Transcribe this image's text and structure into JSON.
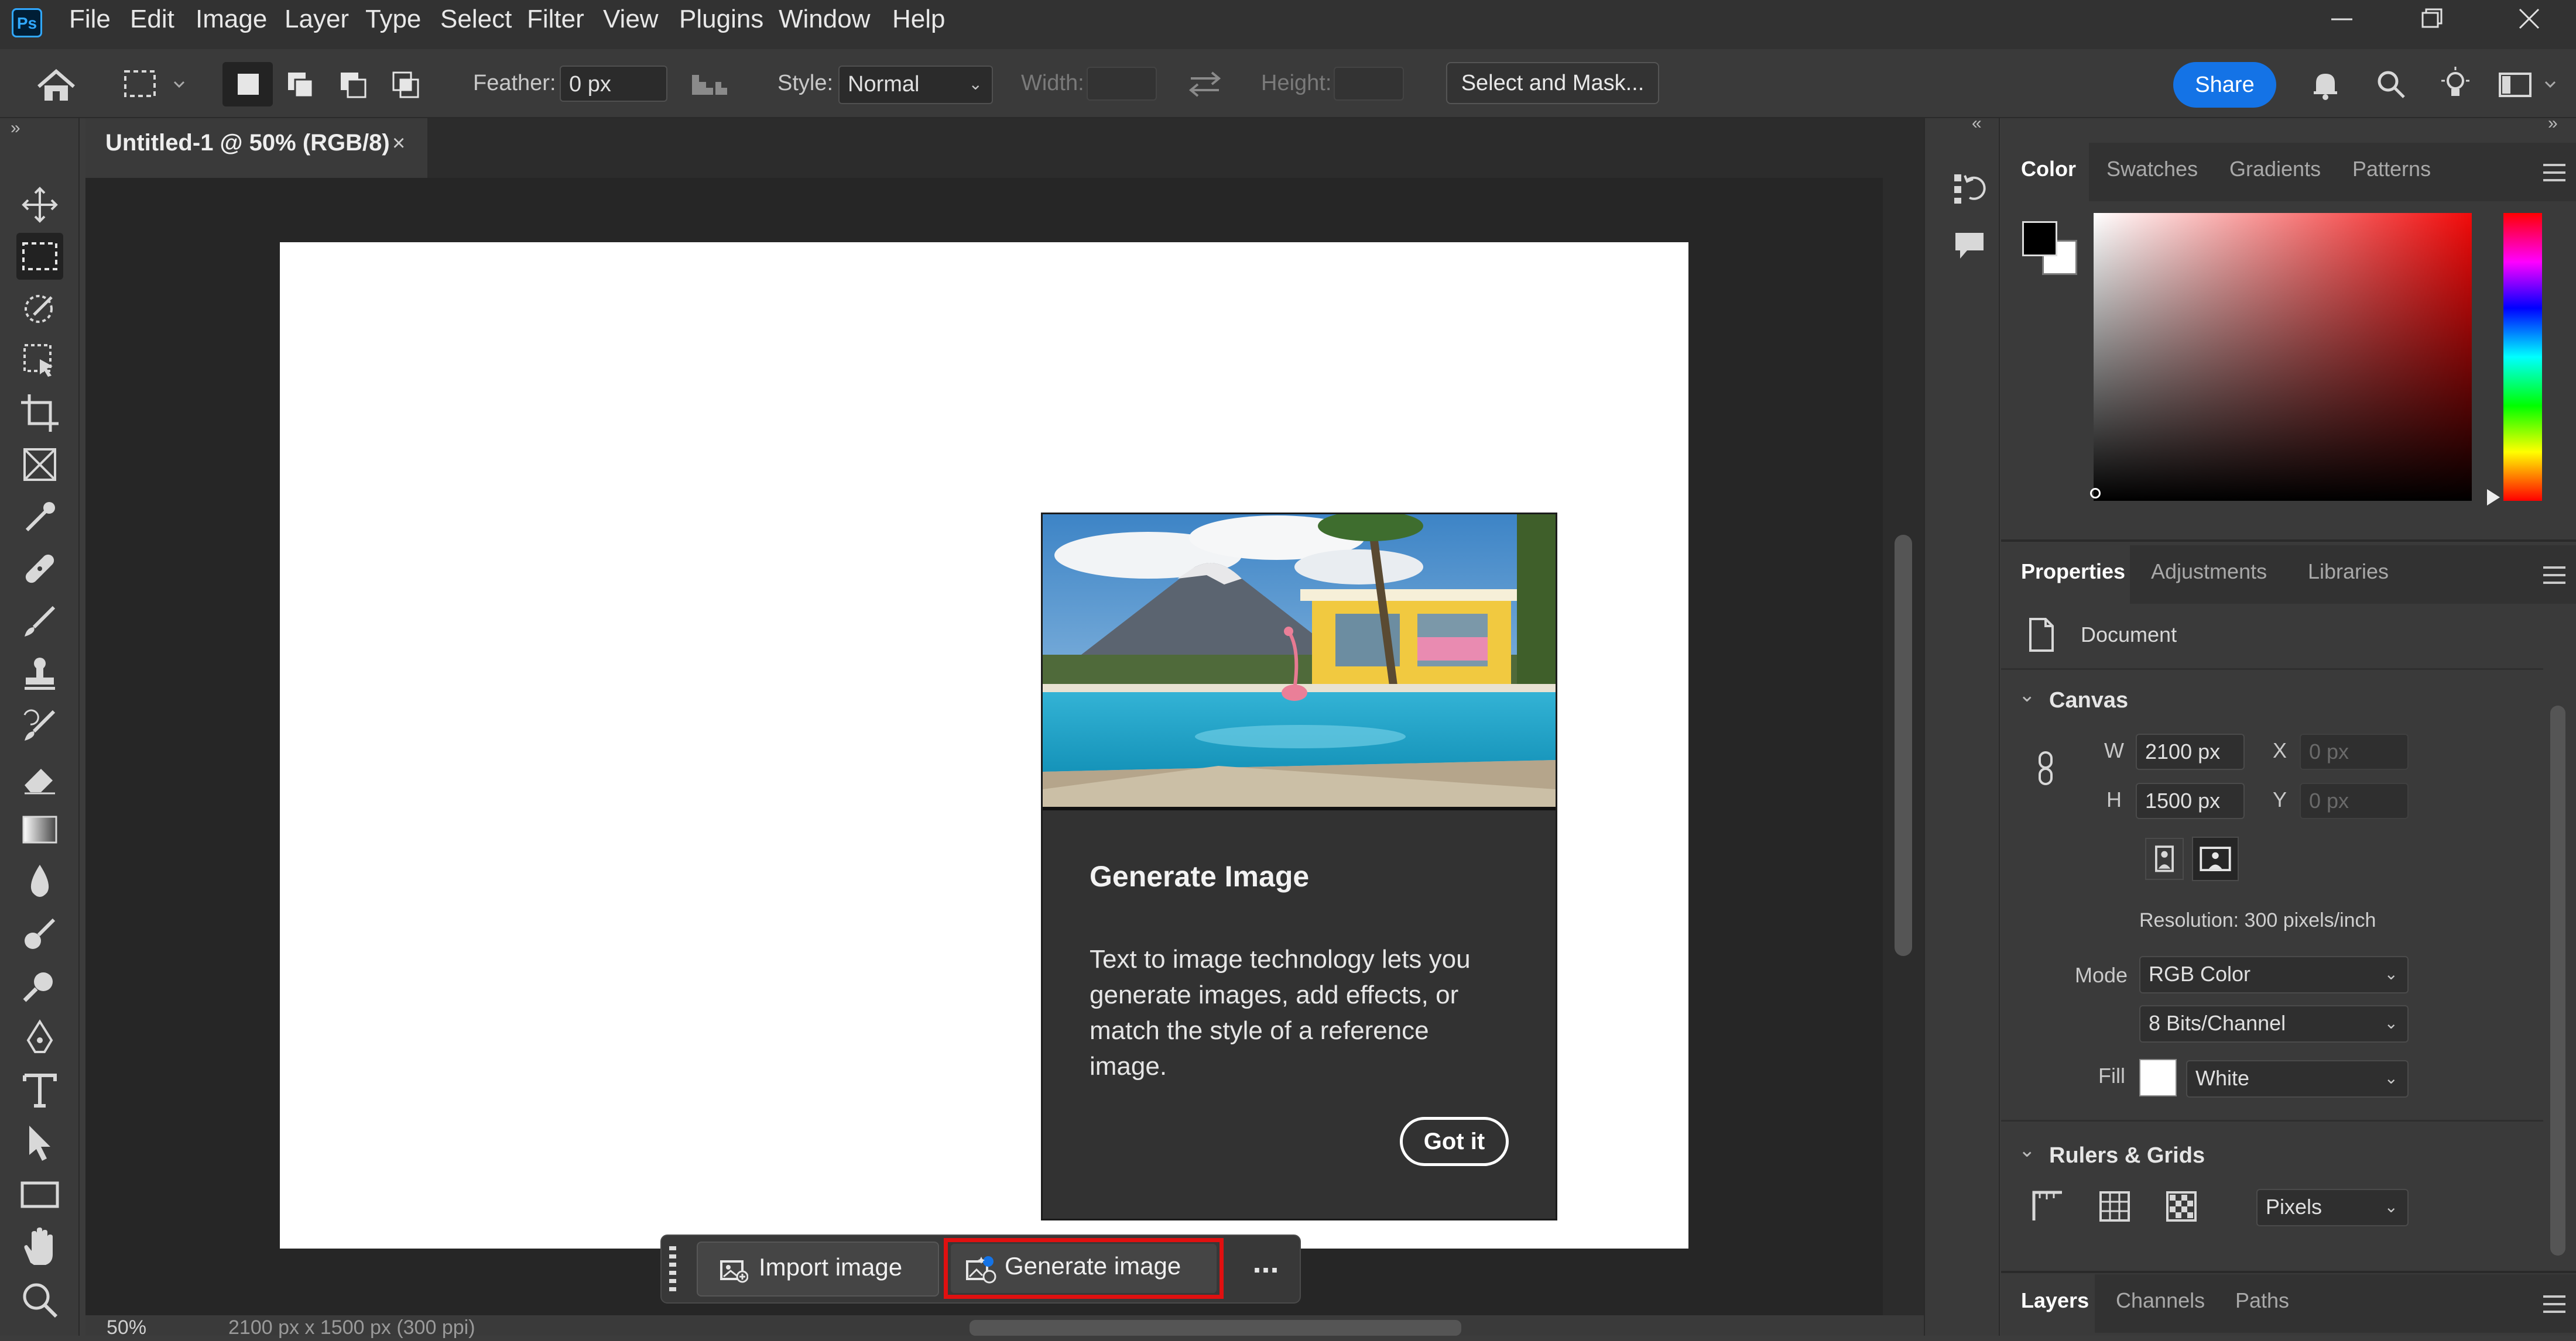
{
  "app": {
    "logo": "Ps"
  },
  "menu": [
    "File",
    "Edit",
    "Image",
    "Layer",
    "Type",
    "Select",
    "Filter",
    "View",
    "Plugins",
    "Window",
    "Help"
  ],
  "options": {
    "feather_label": "Feather:",
    "feather_value": "0 px",
    "style_label": "Style:",
    "style_value": "Normal",
    "width_label": "Width:",
    "height_label": "Height:",
    "select_mask": "Select and Mask...",
    "share": "Share"
  },
  "document_tab": {
    "title": "Untitled-1 @ 50% (RGB/8)",
    "close": "×"
  },
  "popup": {
    "title": "Generate Image",
    "body": "Text to image technology lets you generate images, add effects, or match the style of a reference image.",
    "button": "Got it"
  },
  "contextual_bar": {
    "import": "Import image",
    "generate": "Generate image",
    "more": "..."
  },
  "color_panel": {
    "tabs": [
      "Color",
      "Swatches",
      "Gradients",
      "Patterns"
    ],
    "foreground": "#000000",
    "background": "#ffffff"
  },
  "properties_panel": {
    "tabs": [
      "Properties",
      "Adjustments",
      "Libraries"
    ],
    "doc_label": "Document",
    "canvas_title": "Canvas",
    "w_label": "W",
    "w_value": "2100 px",
    "h_label": "H",
    "h_value": "1500 px",
    "x_label": "X",
    "x_placeholder": "0 px",
    "y_label": "Y",
    "y_placeholder": "0 px",
    "resolution": "Resolution: 300 pixels/inch",
    "mode_label": "Mode",
    "mode_value": "RGB Color",
    "bits_value": "8 Bits/Channel",
    "fill_label": "Fill",
    "fill_value": "White",
    "rulers_title": "Rulers & Grids",
    "units_value": "Pixels"
  },
  "layers_panel": {
    "tabs": [
      "Layers",
      "Channels",
      "Paths"
    ]
  },
  "status": {
    "zoom": "50%",
    "doc_info": "2100 px x 1500 px (300 ppi)"
  },
  "colors": {
    "accent": "#1473e6",
    "highlight": "#e01010",
    "ps_logo_bg": "#001e36",
    "ps_logo_fg": "#31a8ff"
  }
}
